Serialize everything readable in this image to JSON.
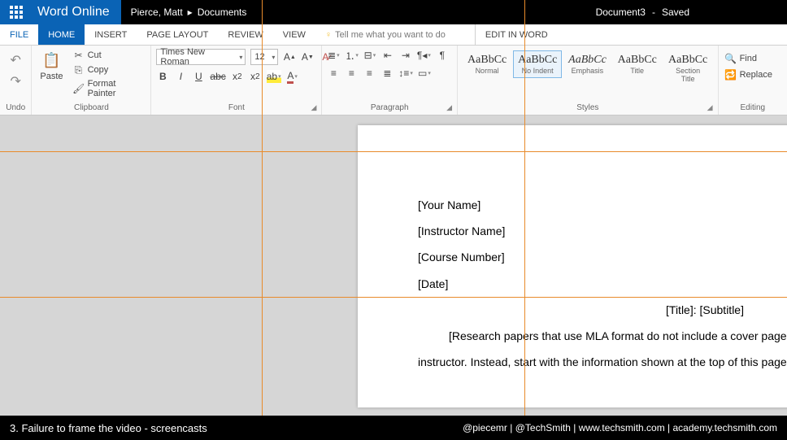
{
  "titlebar": {
    "app": "Word Online",
    "user": "Pierce, Matt",
    "breadcrumb_sep": "▸",
    "location": "Documents",
    "docname": "Document3",
    "dash": "-",
    "status": "Saved"
  },
  "tabs": {
    "file": "FILE",
    "home": "HOME",
    "insert": "INSERT",
    "pagelayout": "PAGE LAYOUT",
    "review": "REVIEW",
    "view": "VIEW",
    "tellme": "Tell me what you want to do",
    "editinword": "EDIT IN WORD"
  },
  "ribbon": {
    "undo": {
      "label": "Undo"
    },
    "clipboard": {
      "label": "Clipboard",
      "paste": "Paste",
      "cut": "Cut",
      "copy": "Copy",
      "fmtpainter": "Format Painter"
    },
    "font": {
      "label": "Font",
      "family": "Times New Roman",
      "size": "12"
    },
    "paragraph": {
      "label": "Paragraph"
    },
    "styles": {
      "label": "Styles",
      "items": [
        {
          "preview": "AaBbCc",
          "name": "Normal"
        },
        {
          "preview": "AaBbCc",
          "name": "No Indent"
        },
        {
          "preview": "AaBbCc",
          "name": "Emphasis"
        },
        {
          "preview": "AaBbCc",
          "name": "Title"
        },
        {
          "preview": "AaBbCc",
          "name": "Section Title"
        }
      ],
      "selected": 1
    },
    "editing": {
      "label": "Editing",
      "find": "Find",
      "replace": "Replace"
    }
  },
  "doc": {
    "line1": "[Your Name]",
    "line2": "[Instructor Name]",
    "line3": "[Course Number]",
    "line4": "[Date]",
    "title": "[Title]: [Subtitle]",
    "body": "[Research papers that use MLA format do not include a cover page unless requested by your instructor. Instead, start with the information shown at the top of this page.  Do not"
  },
  "footer": {
    "left": "3. Failure to frame the video - screencasts",
    "right": "@piecemr | @TechSmith | www.techsmith.com | academy.techsmith.com"
  }
}
